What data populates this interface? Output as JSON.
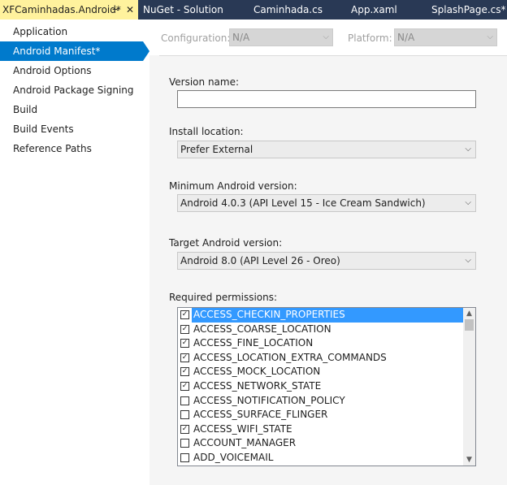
{
  "tabs": [
    {
      "label": "XFCaminhadas.Android*",
      "active": true
    },
    {
      "label": "NuGet - Solution"
    },
    {
      "label": "Caminhada.cs"
    },
    {
      "label": "App.xaml"
    },
    {
      "label": "SplashPage.cs*"
    }
  ],
  "tab_pin_glyph": "⊸",
  "tab_close_glyph": "✕",
  "nav": {
    "items": [
      {
        "label": "Application"
      },
      {
        "label": "Android Manifest*",
        "selected": true
      },
      {
        "label": "Android Options"
      },
      {
        "label": "Android Package Signing"
      },
      {
        "label": "Build"
      },
      {
        "label": "Build Events"
      },
      {
        "label": "Reference Paths"
      }
    ]
  },
  "config": {
    "configuration_label": "Configuration:",
    "configuration_value": "N/A",
    "platform_label": "Platform:",
    "platform_value": "N/A"
  },
  "chevron_glyph": "⌵",
  "form": {
    "version_name_label": "Version name:",
    "version_name_value": "",
    "install_location_label": "Install location:",
    "install_location_value": "Prefer External",
    "min_android_label": "Minimum Android version:",
    "min_android_value": "Android 4.0.3 (API Level 15 - Ice Cream Sandwich)",
    "target_android_label": "Target Android version:",
    "target_android_value": "Android 8.0 (API Level 26 - Oreo)",
    "permissions_label": "Required permissions:"
  },
  "check_glyph": "✓",
  "permissions": [
    {
      "name": "ACCESS_CHECKIN_PROPERTIES",
      "checked": true,
      "selected": true
    },
    {
      "name": "ACCESS_COARSE_LOCATION",
      "checked": true
    },
    {
      "name": "ACCESS_FINE_LOCATION",
      "checked": true
    },
    {
      "name": "ACCESS_LOCATION_EXTRA_COMMANDS",
      "checked": true
    },
    {
      "name": "ACCESS_MOCK_LOCATION",
      "checked": true
    },
    {
      "name": "ACCESS_NETWORK_STATE",
      "checked": true
    },
    {
      "name": "ACCESS_NOTIFICATION_POLICY",
      "checked": false
    },
    {
      "name": "ACCESS_SURFACE_FLINGER",
      "checked": false
    },
    {
      "name": "ACCESS_WIFI_STATE",
      "checked": true
    },
    {
      "name": "ACCOUNT_MANAGER",
      "checked": false
    },
    {
      "name": "ADD_VOICEMAIL",
      "checked": false
    }
  ],
  "scroll_up_glyph": "▲",
  "scroll_down_glyph": "▼",
  "colors": {
    "accent": "#007acc",
    "active_tab": "#fff29d",
    "tab_strip": "#293955",
    "list_selection": "#3399ff"
  }
}
